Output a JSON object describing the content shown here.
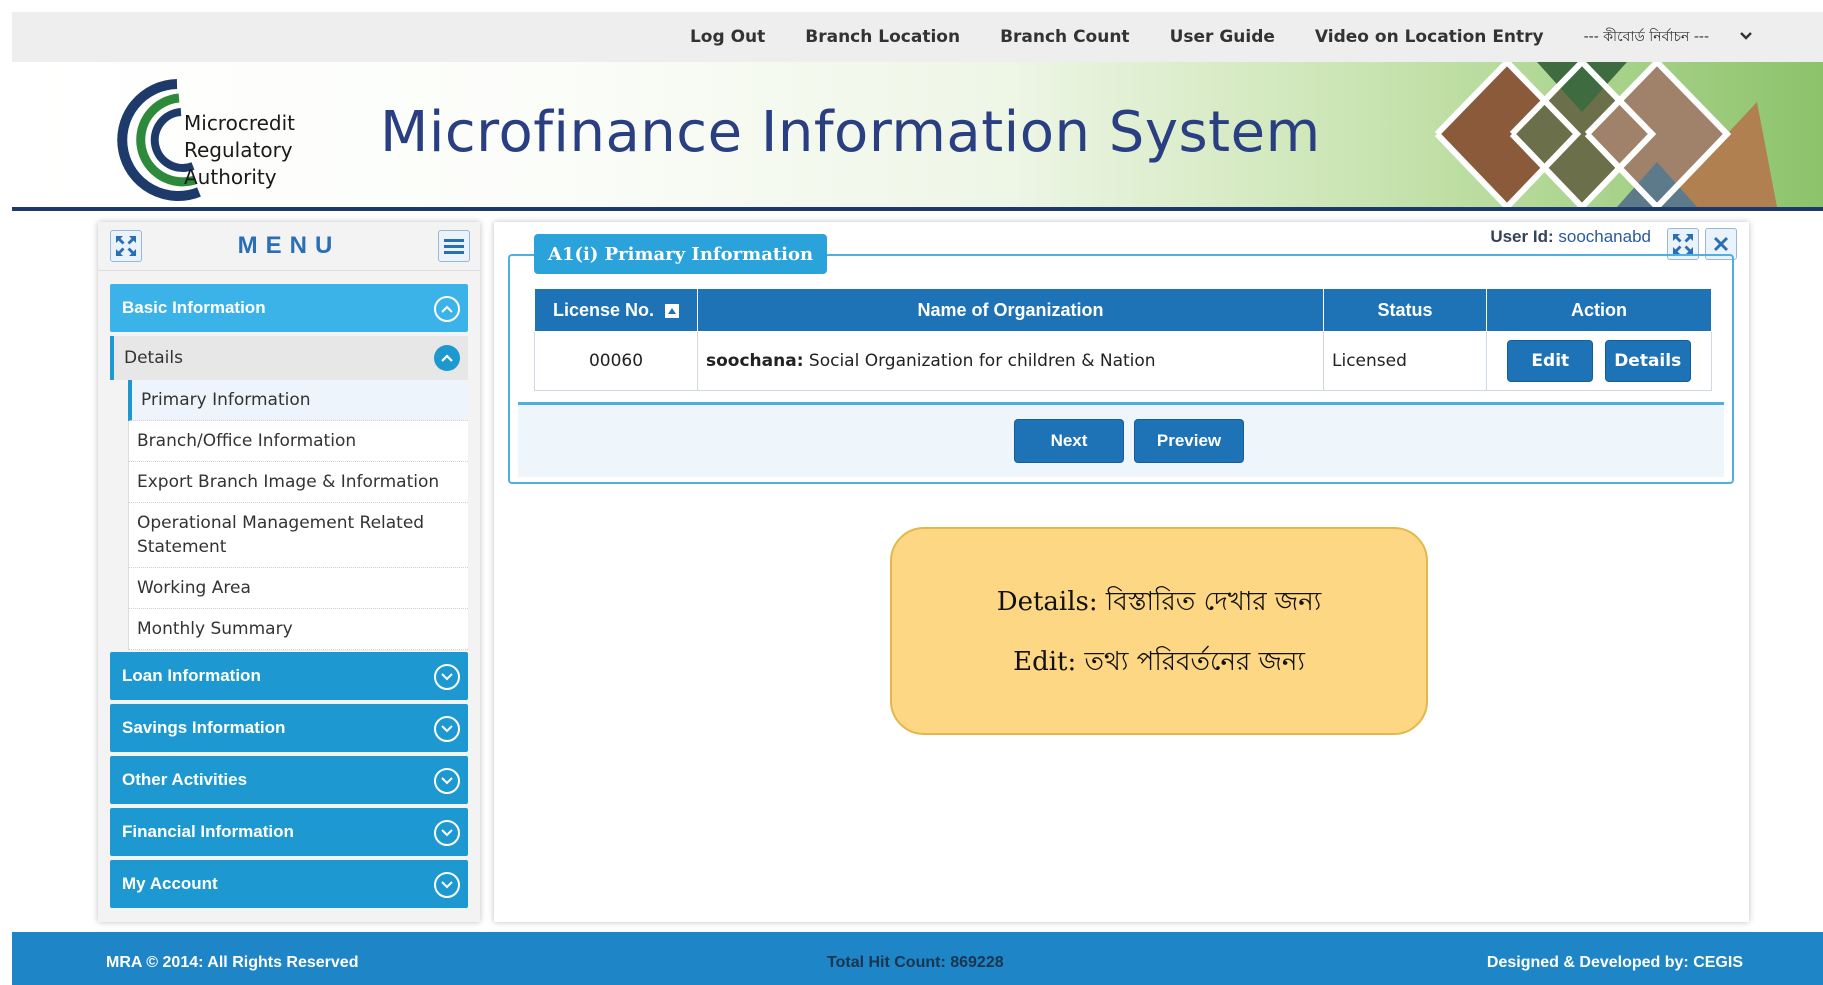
{
  "topnav": {
    "links": [
      "Log Out",
      "Branch Location",
      "Branch Count",
      "User Guide",
      "Video on Location Entry"
    ],
    "keyboard_select": "--- কীবোর্ড নির্বাচন ---"
  },
  "banner": {
    "logo_lines": [
      "Microcredit",
      "Regulatory",
      "Authority"
    ],
    "title": "Microfinance Information System"
  },
  "menu": {
    "title": "MENU",
    "sections": [
      "Basic Information",
      "Loan Information",
      "Savings Information",
      "Other Activities",
      "Financial Information",
      "My Account"
    ],
    "details_label": "Details",
    "sub_items": [
      "Primary Information",
      "Branch/Office Information",
      "Export Branch Image & Information",
      "Operational Management Related Statement",
      "Working Area",
      "Monthly Summary"
    ]
  },
  "panel": {
    "user_id_label": "User Id:",
    "user_id": "soochanabd",
    "legend": "A1(i) Primary Information",
    "columns": [
      "License No.",
      "Name of Organization",
      "Status",
      "Action"
    ],
    "row": {
      "license": "00060",
      "org_short": "soochana:",
      "org_full": "Social Organization for children & Nation",
      "status": "Licensed",
      "edit": "Edit",
      "details": "Details"
    },
    "next": "Next",
    "preview": "Preview"
  },
  "note": {
    "line1_label": "Details:",
    "line1_text": "বিস্তারিত দেখার জন্য",
    "line2_label": "Edit:",
    "line2_text": "তথ্য পরিবর্তনের জন্য"
  },
  "footer": {
    "copyright_brand": "MRA",
    "copyright": "© 2014: All Rights Reserved",
    "hit_count": "Total Hit Count: 869228",
    "designed_label": "Designed & Developed by:",
    "designed_by": "CEGIS"
  },
  "colors": {
    "primary": "#1e73b7",
    "menu_section": "#1e98d0",
    "footer": "#1e85c6",
    "note": "#fdd784"
  }
}
